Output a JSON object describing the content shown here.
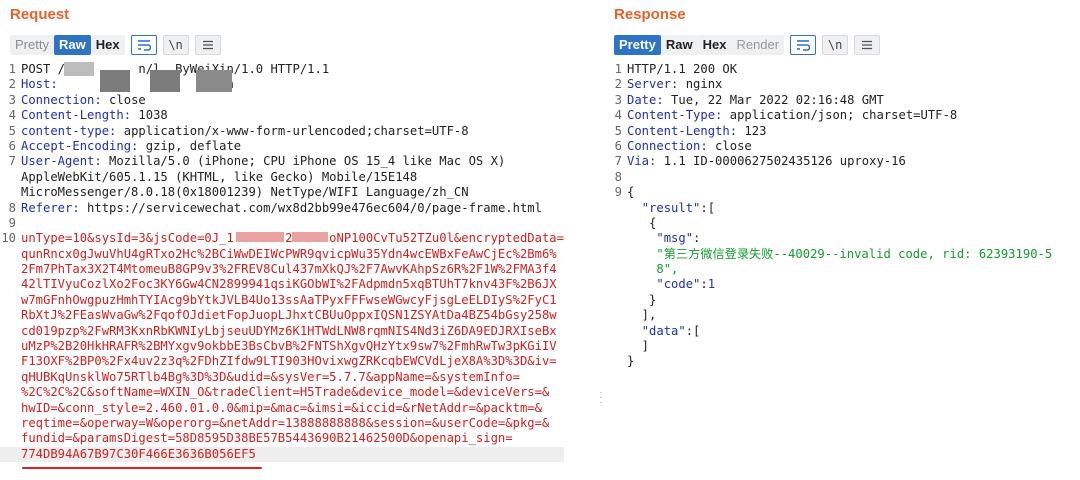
{
  "request": {
    "title": "Request",
    "toolbar": {
      "pretty": "Pretty",
      "raw": "Raw",
      "hex": "Hex",
      "newline": "\\n"
    },
    "lines": [
      {
        "n": "1",
        "text": "POST /          n/l  ByWeiXin/1.0 HTTP/1.1"
      },
      {
        "n": "2",
        "key": "Host:",
        "val": "                       n"
      },
      {
        "n": "3",
        "key": "Connection:",
        "val": " close"
      },
      {
        "n": "4",
        "key": "Content-Length:",
        "val": " 1038"
      },
      {
        "n": "5",
        "key": "content-type:",
        "val": " application/x-www-form-urlencoded;charset=UTF-8"
      },
      {
        "n": "6",
        "key": "Accept-Encoding:",
        "val": " gzip, deflate"
      },
      {
        "n": "7",
        "key": "User-Agent:",
        "val": " Mozilla/5.0 (iPhone; CPU iPhone OS 15_4 like Mac OS X)"
      },
      {
        "n": "",
        "cont": "AppleWebKit/605.1.15 (KHTML, like Gecko) Mobile/15E148"
      },
      {
        "n": "",
        "cont": "MicroMessenger/8.0.18(0x18001239) NetType/WIFI Language/zh_CN"
      },
      {
        "n": "8",
        "key": "Referer:",
        "val": " https://servicewechat.com/wx8d2bb99e476ec604/0/page-frame.html"
      },
      {
        "n": "9",
        "text": ""
      }
    ],
    "body_number": "10",
    "body_lines": [
      "unType=10&sysId=3&jsCode=0J_1 '   'I2    'oNP100CvTu52TZu0l&encryptedData=",
      "qunRncx0gJwuVhU4gRTxo2Hc%2BCiWwDEIWcPWR9qvicpWu35Ydn4wcEWBxFeAwCjEc%2Bm6%",
      "2Fm7PhTax3X2T4MtomeuB8GP9v3%2FREV8Cul437mXkQJ%2F7AwvKAhpSz6R%2F1W%2FMA3f4",
      "42lTIVyuCozlXo2Foc3KY6Gw4CN2899941qsiKGObWI%2FAdpmdn5xqBTUhT7knv43F%2B6JX",
      "w7mGFnhOwgpuzHmhTYIAcg9bYtkJVLB4Uo13ssAaTPyxFFFwseWGwcyFjsgLeELDIyS%2FyC1",
      "RbXtJ%2FEasWvaGw%2FqofOJdietFopJuopLJhxtCBUuOppxIQSN1ZSYAtDa4BZ54bGsy258w",
      "cd019pzp%2FwRM3KxnRbKWNIyLbjseuUDYMz6K1HTWdLNW8rqmNIS4Nd3iZ6DA9EDJRXIseBx",
      "uMzP%2B20HkHRAFR%2BMYxgv9okbbE3BsCbvB%2FNTShXgvQHzYtx9sw7%2FmhRwTw3pKGiIV",
      "F13OXF%2BP0%2Fx4uv2z3q%2FDhZIfdw9LTI903HOvixwgZRKcqbEWCVdLjeX8A%3D%3D&iv=",
      "qHUBKqUnsklWo75RTlb4Bg%3D%3D&udid=&sysVer=5.7.7&appName=&systemInfo=",
      "%2C%2C%2C&softName=WXIN_O&tradeClient=H5Trade&device_model=&deviceVers=&",
      "hwID=&conn_style=2.460.01.0.0&mip=&mac=&imsi=&iccid=&rNetAddr=&packtm=&",
      "reqtime=&operway=W&operorg=&netAddr=13888888888&session=&userCode=&pkg=&",
      "fundid=&paramsDigest=58D8595D38BE57B5443690B21462500D&openapi_sign=",
      "774DB94A67B97C30F466E3636B056EF5"
    ]
  },
  "response": {
    "title": "Response",
    "toolbar": {
      "pretty": "Pretty",
      "raw": "Raw",
      "hex": "Hex",
      "render": "Render",
      "newline": "\\n"
    },
    "headers": [
      {
        "n": "1",
        "text": "HTTP/1.1 200 OK"
      },
      {
        "n": "2",
        "key": "Server:",
        "val": " nginx"
      },
      {
        "n": "3",
        "key": "Date:",
        "val": " Tue, 22 Mar 2022 02:16:48 GMT"
      },
      {
        "n": "4",
        "key": "Content-Type:",
        "val": " application/json; charset=UTF-8"
      },
      {
        "n": "5",
        "key": "Content-Length:",
        "val": " 123"
      },
      {
        "n": "6",
        "key": "Connection:",
        "val": " close"
      },
      {
        "n": "7",
        "key": "Via:",
        "val": " 1.1 ID-0000627502435126 uproxy-16"
      },
      {
        "n": "8",
        "text": ""
      },
      {
        "n": "9",
        "text": "{"
      }
    ],
    "json": {
      "result_key": "\"result\"",
      "msg_key": "\"msg\"",
      "msg_val_1": "\"第三方微信登录失败--40029--invalid code, rid: 62393190-5",
      "msg_val_2": "8\",",
      "code_key": "\"code\"",
      "code_val": "1",
      "data_key": "\"data\""
    }
  },
  "colors": {
    "accent": "#e8622a",
    "active": "#2f74c4",
    "header_key": "#1f2fb6",
    "body_red": "#d42020",
    "json_string": "#139c2e"
  }
}
